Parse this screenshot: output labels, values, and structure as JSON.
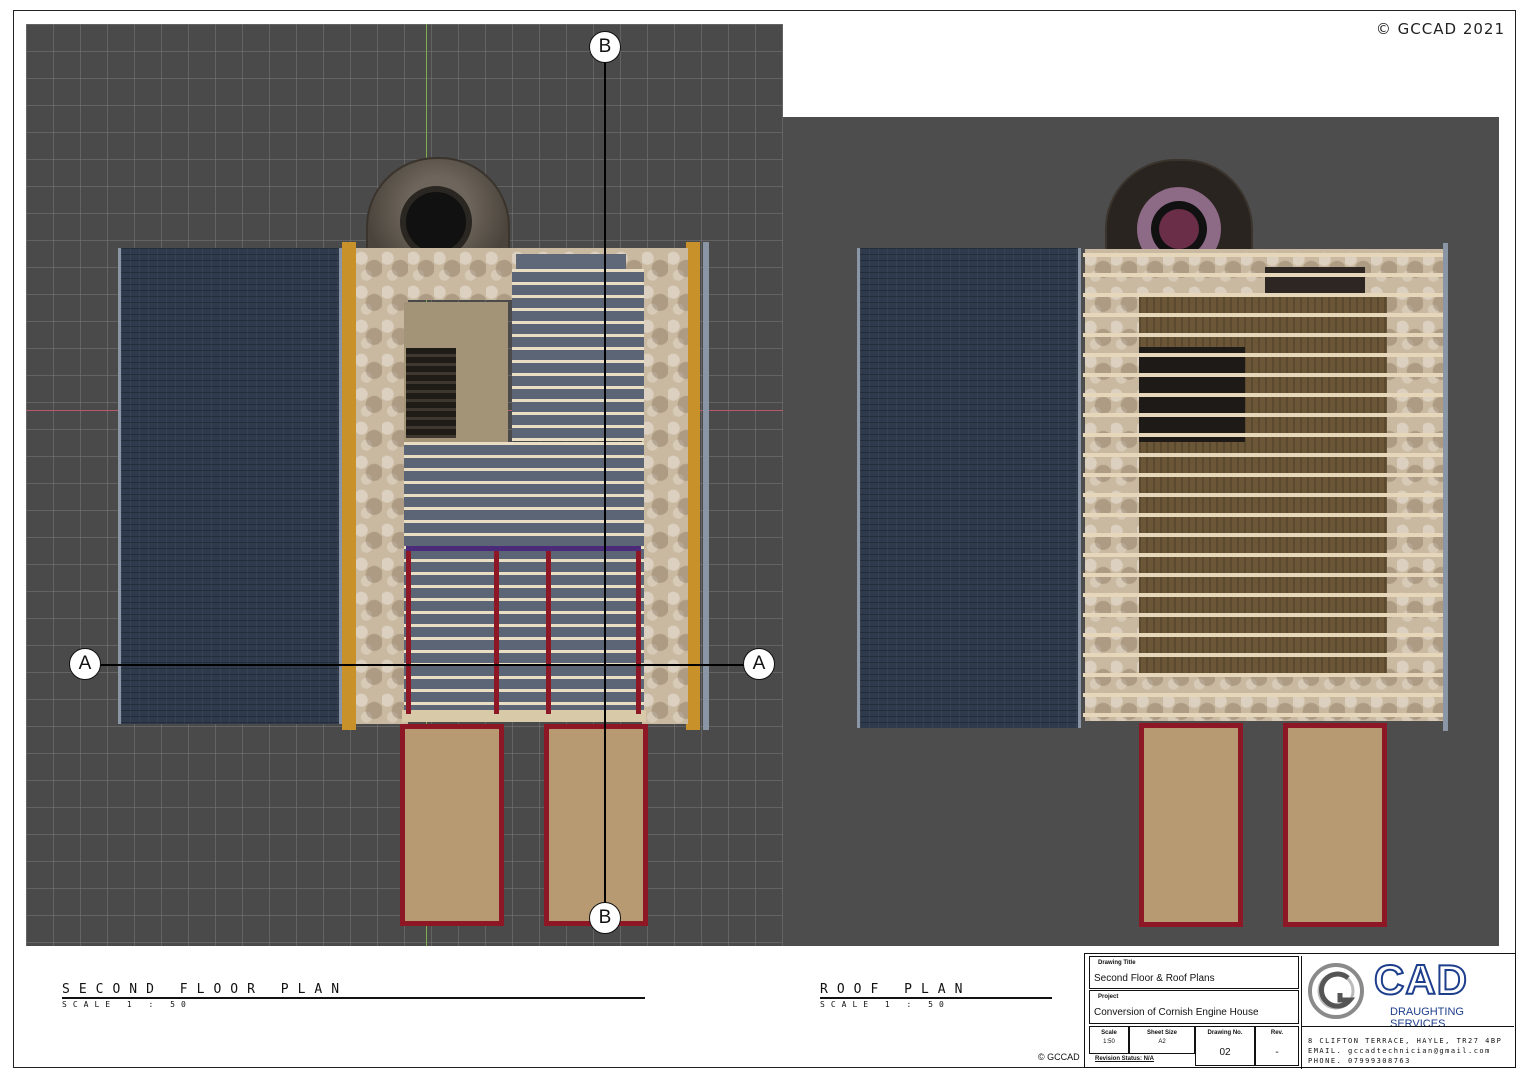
{
  "sheet": {
    "copyright": "© GCCAD 2021",
    "footer_copyright": "© GCCAD"
  },
  "section_markers": {
    "a": "A",
    "b": "B"
  },
  "plans": [
    {
      "title": "SECOND FLOOR PLAN",
      "scale": "SCALE 1 : 50"
    },
    {
      "title": "ROOF PLAN",
      "scale": "SCALE 1 : 50"
    }
  ],
  "title_block": {
    "drawing_title_label": "Drawing Title",
    "drawing_title": "Second Floor & Roof Plans",
    "project_label": "Project",
    "project": "Conversion of Cornish Engine House",
    "scale_label": "Scale",
    "scale_value": "1:50",
    "sheet_size_label": "Sheet Size",
    "sheet_size_value": "A2",
    "drawing_no_label": "Drawing No.",
    "drawing_no_value": "02",
    "rev_label": "Rev.",
    "rev_value": "-",
    "revision_status": "Revision Status: N/A"
  },
  "company": {
    "logo_text": "CAD",
    "logo_sub": "DRAUGHTING SERVICES",
    "address_line": "8 CLIFTON TERRACE, HAYLE, TR27 4BP",
    "email_line": "EMAIL. gccadtechnician@gmail.com",
    "phone_line": "PHONE. 07999308763"
  },
  "colors": {
    "background_grid": "#4a4a4a",
    "roof_slate": "#2f3b4c",
    "porch_frame": "#8e1726",
    "logo_blue": "#1d3e8c"
  }
}
